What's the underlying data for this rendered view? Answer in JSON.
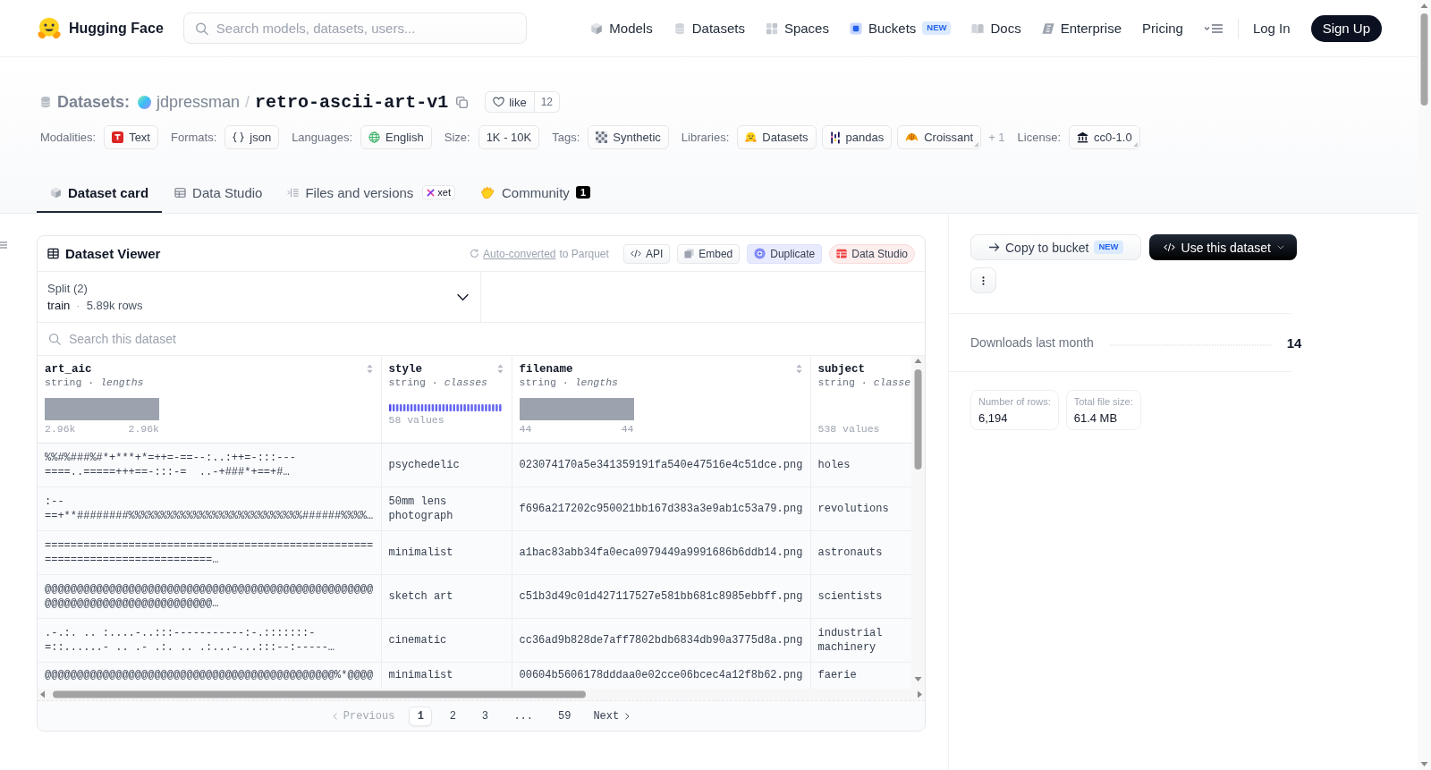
{
  "nav": {
    "brand": "Hugging Face",
    "search": {
      "placeholder": "Search models, datasets, users..."
    },
    "links": [
      {
        "label": "Models"
      },
      {
        "label": "Datasets"
      },
      {
        "label": "Spaces"
      },
      {
        "label": "Buckets",
        "badge": "NEW"
      },
      {
        "label": "Docs"
      },
      {
        "label": "Enterprise"
      },
      {
        "label": "Pricing"
      }
    ],
    "login": "Log In",
    "signup": "Sign Up"
  },
  "repo": {
    "section": "Datasets:",
    "owner": "jdpressman",
    "separator": "/",
    "name": "retro-ascii-art-v1",
    "like": {
      "label": "like",
      "count": "12"
    },
    "meta": [
      {
        "label": "Modalities:",
        "chips": [
          {
            "text": "Text",
            "dropdown": false
          }
        ]
      },
      {
        "label": "Formats:",
        "chips": [
          {
            "text": "json",
            "dropdown": false
          }
        ]
      },
      {
        "label": "Languages:",
        "chips": [
          {
            "text": "English",
            "dropdown": false
          }
        ]
      },
      {
        "label": "Size:",
        "chips": [
          {
            "text": "1K - 10K",
            "dropdown": false
          }
        ]
      },
      {
        "label": "Tags:",
        "chips": [
          {
            "text": "Synthetic",
            "dropdown": false
          }
        ]
      },
      {
        "label": "Libraries:",
        "chips": [
          {
            "text": "Datasets",
            "dropdown": false
          },
          {
            "text": "pandas",
            "dropdown": false
          },
          {
            "text": "Croissant",
            "dropdown": true
          }
        ],
        "more": "+ 1"
      },
      {
        "label": "License:",
        "chips": [
          {
            "text": "cc0-1.0",
            "dropdown": true
          }
        ]
      }
    ]
  },
  "tabs": [
    {
      "label": "Dataset card",
      "selected": true
    },
    {
      "label": "Data Studio",
      "selected": false
    },
    {
      "label": "Files and versions",
      "badge": "xet",
      "selected": false
    },
    {
      "label": "Community",
      "count": "1",
      "selected": false
    }
  ],
  "viewer": {
    "title": "Dataset Viewer",
    "conversion": {
      "link": "Auto-converted",
      "text": "to Parquet"
    },
    "buttons": [
      {
        "label": "API"
      },
      {
        "label": "Embed"
      },
      {
        "label": "Duplicate"
      },
      {
        "label": "Data Studio"
      }
    ],
    "split": {
      "label": "Split (2)",
      "value": "train",
      "separator": "·",
      "rows": "5.89k rows"
    },
    "search": {
      "placeholder": "Search this dataset"
    },
    "columns": [
      {
        "name": "art_aic",
        "type": "string · *lengths*",
        "sortable": true,
        "summary": {
          "kind": "histogram",
          "min": "2.96k",
          "max": "2.96k"
        }
      },
      {
        "name": "style",
        "type": "string · *classes*",
        "sortable": true,
        "summary": {
          "kind": "classes",
          "label": "58 values"
        }
      },
      {
        "name": "filename",
        "type": "string · *lengths*",
        "sortable": true,
        "summary": {
          "kind": "histogram",
          "min": "44",
          "max": "44"
        }
      },
      {
        "name": "subject",
        "type": "string · *classe*",
        "sortable": false,
        "summary": {
          "kind": "count",
          "label": "538 values"
        }
      }
    ],
    "rows": [
      {
        "cells": [
          "%%#%###%#*+***+*=++=-==--:..:++=-:::---\n====..=====+++==-:::-=  ..-+###*+==+#…",
          "psychedelic",
          "023074170a5e341359191fa540e47516e4c51dce.png",
          "holes"
        ]
      },
      {
        "cells": [
          ":--\n==+**########%%%%%%%%%%%%%%%%%%%%%%%%%%%######%%%%…",
          "50mm lens photograph",
          "f696a217202c950021bb167d383a3e9ab1c53a79.png",
          "revolutions"
        ]
      },
      {
        "cells": [
          "===================================================\n==========================…",
          "minimalist",
          "a1bac83abb34fa0eca0979449a9991686b6ddb14.png",
          "astronauts"
        ]
      },
      {
        "cells": [
          "@@@@@@@@@@@@@@@@@@@@@@@@@@@@@@@@@@@@@@@@@@@@@@@@@@@\n@@@@@@@@@@@@@@@@@@@@@@@@@@…",
          "sketch art",
          "c51b3d49c01d427117527e581bb681c8985ebbff.png",
          "scientists"
        ]
      },
      {
        "cells": [
          ".-.:. .. :....-..:::-----------:-.:::::::-\n=::......- .. .- .:. .. .:...-...:::--:-----…",
          "cinematic",
          "cc36ad9b828de7aff7802bdb6834db90a3775d8a.png",
          "industrial machinery"
        ]
      },
      {
        "cells": [
          "@@@@@@@@@@@@@@@@@@@@@@@@@@@@@@@@@@@@@@@@@@@@@%*@@@@",
          "minimalist",
          "00604b5606178dddaa0e02cce06bcec4a12f8b62.png",
          "faerie"
        ]
      }
    ],
    "pagination": {
      "previous": {
        "label": "Previous",
        "disabled": true
      },
      "pages": [
        {
          "label": "1",
          "selected": true
        },
        {
          "label": "2",
          "selected": false
        },
        {
          "label": "3",
          "selected": false
        },
        {
          "label": "...",
          "selected": false
        },
        {
          "label": "59",
          "selected": false
        }
      ],
      "next": {
        "label": "Next",
        "disabled": false
      }
    }
  },
  "sidebar": {
    "actions": [
      {
        "label": "Copy to bucket",
        "badge": "NEW",
        "kind": "secondary"
      },
      {
        "label": "Use this dataset",
        "kind": "primary"
      }
    ],
    "downloads": {
      "label": "Downloads last month",
      "value": "14"
    },
    "stats": [
      {
        "label": "Number of rows:",
        "value": "6,194"
      },
      {
        "label": "Total file size:",
        "value": "61.4 MB"
      }
    ]
  }
}
